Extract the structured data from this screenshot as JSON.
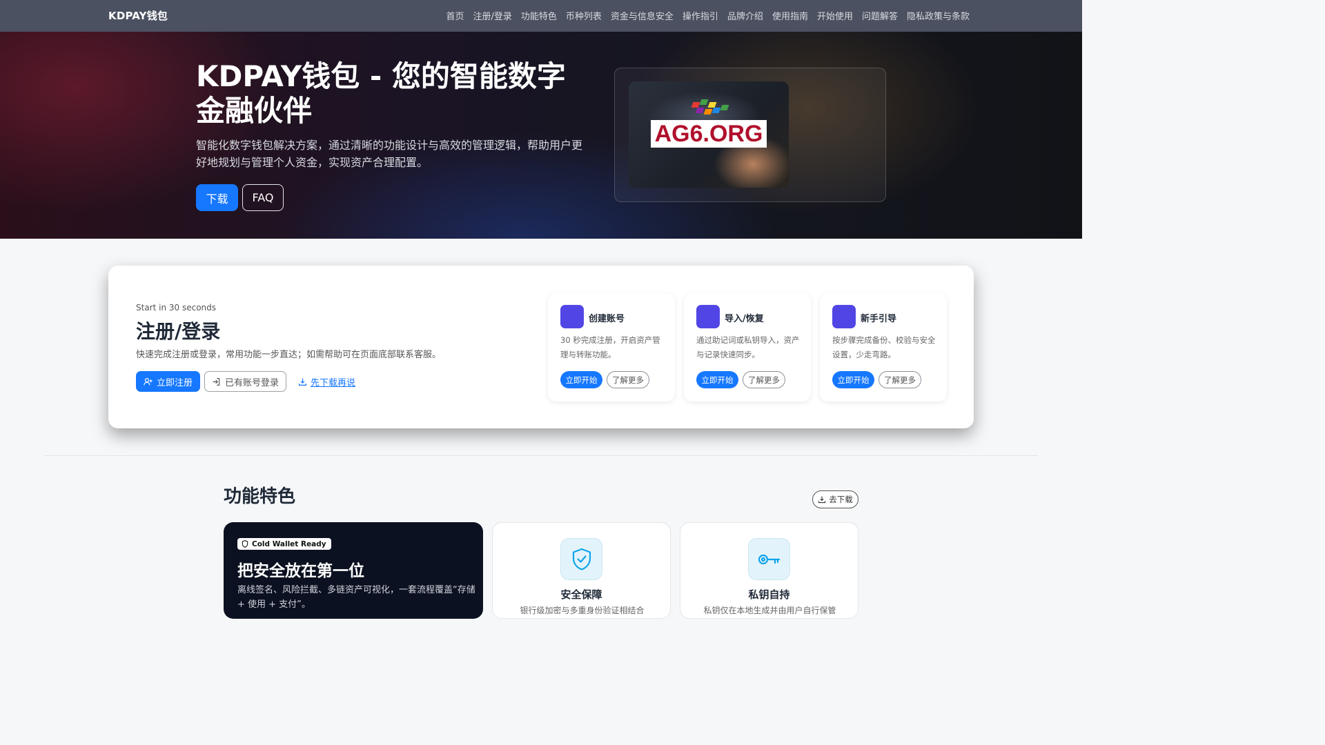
{
  "navbar": {
    "brand": "KDPAY钱包",
    "links": [
      "首页",
      "注册/登录",
      "功能特色",
      "币种列表",
      "资金与信息安全",
      "操作指引",
      "品牌介绍",
      "使用指南",
      "开始使用",
      "问题解答",
      "隐私政策与条款"
    ]
  },
  "hero": {
    "title": "KDPAY钱包 - 您的智能数字金融伙伴",
    "description": "智能化数字钱包解决方案，通过清晰的功能设计与高效的管理逻辑，帮助用户更好地规划与管理个人资金，实现资产合理配置。",
    "download_label": "下载",
    "faq_label": "FAQ",
    "image_watermark": "AG6.ORG"
  },
  "register": {
    "eyebrow": "Start in 30 seconds",
    "title": "注册/登录",
    "description": "快速完成注册或登录，常用功能一步直达；如需帮助可在页面底部联系客服。",
    "register_label": "立即注册",
    "login_label": "已有账号登录",
    "download_first_label": "先下载再说",
    "cards": [
      {
        "title": "创建账号",
        "description": "30 秒完成注册，开启资产管理与转账功能。",
        "start_label": "立即开始",
        "more_label": "了解更多"
      },
      {
        "title": "导入/恢复",
        "description": "通过助记词或私钥导入，资产与记录快速同步。",
        "start_label": "立即开始",
        "more_label": "了解更多"
      },
      {
        "title": "新手引导",
        "description": "按步骤完成备份、校验与安全设置，少走弯路。",
        "start_label": "立即开始",
        "more_label": "了解更多"
      }
    ]
  },
  "features": {
    "title": "功能特色",
    "goto_download_label": "去下载",
    "highlight": {
      "badge": "Cold Wallet Ready",
      "title": "把安全放在第一位",
      "description": "离线签名、风险拦截、多链资产可视化，一套流程覆盖“存储 + 使用 + 支付”。"
    },
    "cards": [
      {
        "title": "安全保障",
        "icon": "shield-check-icon",
        "description": "银行级加密与多重身份验证相结合"
      },
      {
        "title": "私钥自持",
        "icon": "key-icon",
        "description": "私钥仅在本地生成并由用户自行保管"
      }
    ]
  },
  "colors": {
    "primary": "#1677ff",
    "navbar": "#4b5160",
    "mini_icon": "#5146e5",
    "feature_icon": "#0ea5e9"
  }
}
